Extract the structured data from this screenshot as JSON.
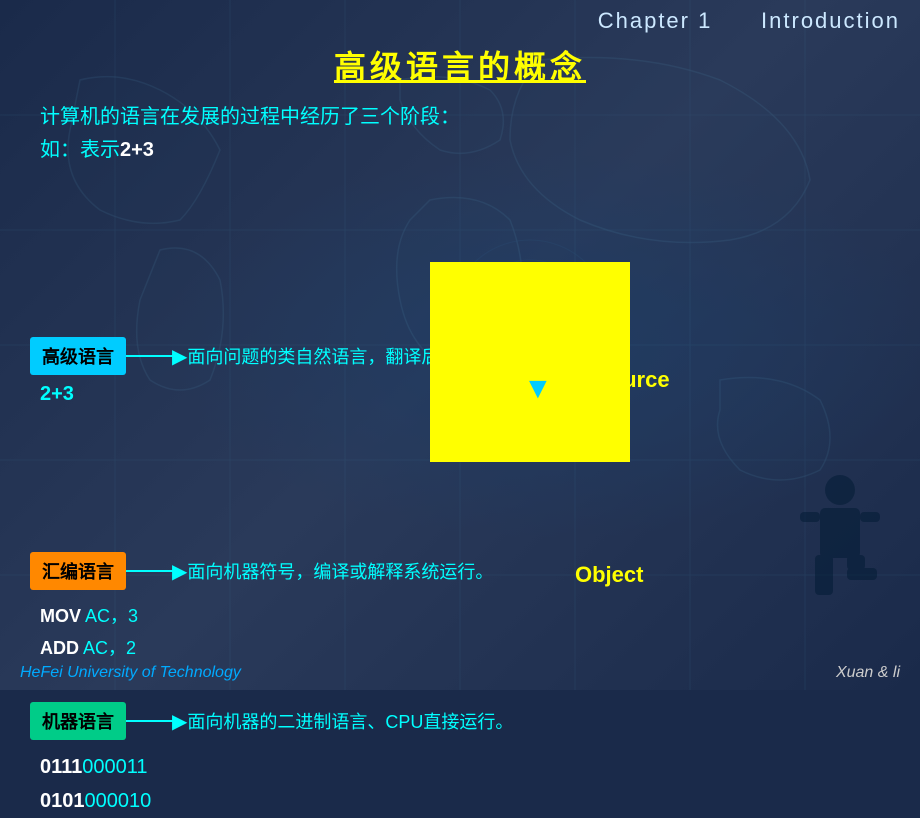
{
  "header": {
    "chapter": "Chapter 1",
    "section": "Introduction"
  },
  "title": "高级语言的概念",
  "intro": {
    "line1": "计算机的语言在发展的过程中经历了三个阶段：",
    "line2_prefix": "如：表示",
    "line2_bold": "2+3"
  },
  "high_level": {
    "label": "高级语言",
    "description": "面向问题的类自然语言，翻译后运行。",
    "code": "2+3",
    "source_label": "Source"
  },
  "asm_level": {
    "label": "汇编语言",
    "description": "面向机器符号，编译或解释系统运行。",
    "code_line1_white": "MOV",
    "code_line1_rest": "  AC，3",
    "code_line2_white": "ADD",
    "code_line2_rest": "  AC，2",
    "object_label": "Object"
  },
  "machine_level": {
    "label": "机器语言",
    "description": "面向机器的二进制语言、CPU直接运行。",
    "code_line1_bold1": "0111",
    "code_line1_rest1": "000011",
    "code_line2_bold1": "0101",
    "code_line2_rest1": "000010"
  },
  "footer": {
    "left": "HeFei University of Technology",
    "right": "Xuan & li"
  }
}
